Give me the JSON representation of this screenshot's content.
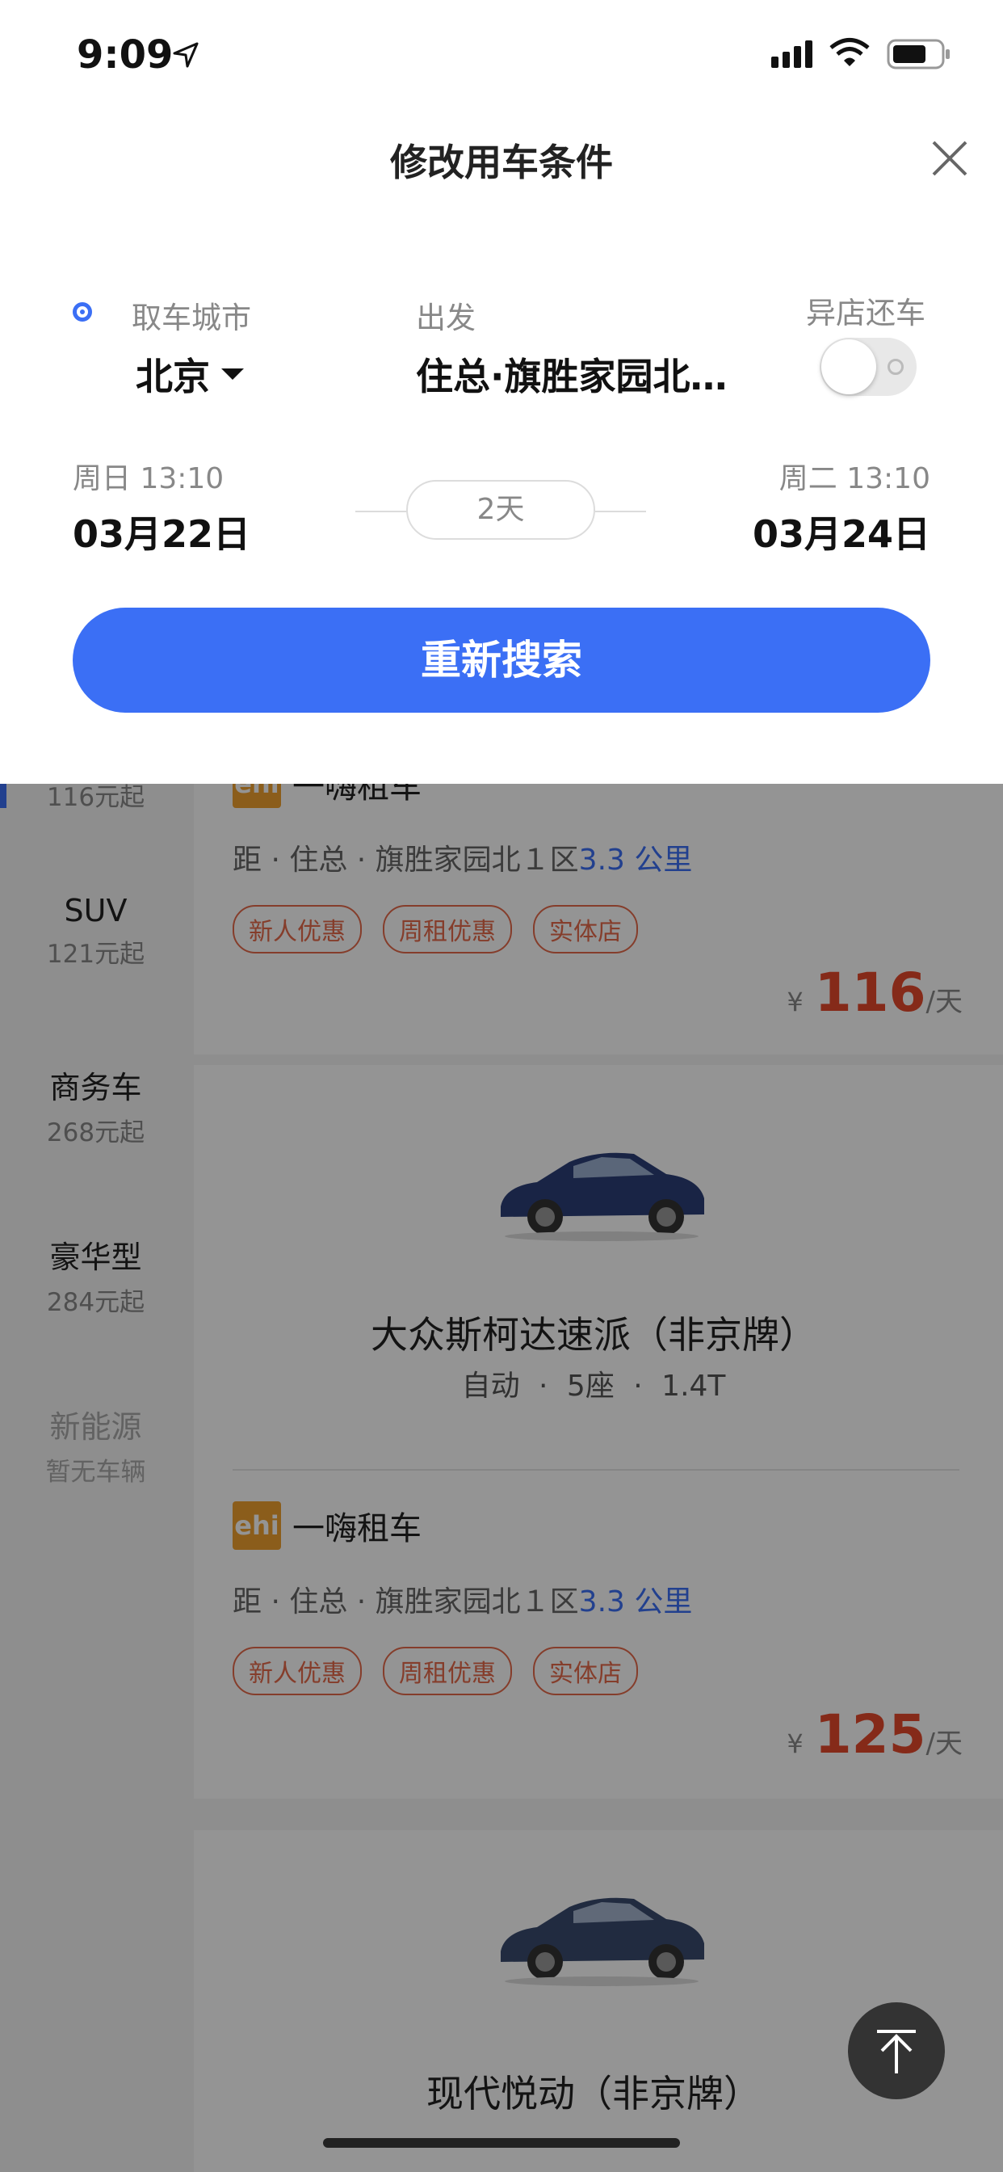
{
  "status_bar": {
    "time": "9:09"
  },
  "modal": {
    "title": "修改用车条件",
    "pickup_city_label": "取车城市",
    "pickup_city": "北京",
    "depart_label": "出发",
    "depart_value": "住总·旗胜家园北…",
    "return_other_label": "异店还车",
    "return_other_on": false,
    "start_weekday_time": "周日 13:10",
    "start_date": "03月22日",
    "duration": "2天",
    "end_weekday_time": "周二 13:10",
    "end_date": "03月24日",
    "search_button": "重新搜索"
  },
  "sidebar": {
    "items": [
      {
        "name": "",
        "sub": "116元起"
      },
      {
        "name": "SUV",
        "sub": "121元起"
      },
      {
        "name": "商务车",
        "sub": "268元起"
      },
      {
        "name": "豪华型",
        "sub": "284元起"
      },
      {
        "name": "新能源",
        "sub": "暂无车辆",
        "disabled": true
      }
    ]
  },
  "cars": [
    {
      "vendor": "一嗨租车",
      "distance_prefix": "距 · 住总 · 旗胜家园北１区",
      "distance_km": "3.3 公里",
      "tags": [
        "新人优惠",
        "周租优惠",
        "实体店"
      ],
      "price_currency": "¥",
      "price": "116",
      "price_unit": "/天"
    },
    {
      "title": "大众斯柯达速派（非京牌）",
      "spec": "自动 · 5座 · 1.4T",
      "vendor_logo": "ehi",
      "vendor": "一嗨租车",
      "distance_prefix": "距 · 住总 · 旗胜家园北１区",
      "distance_km": "3.3 公里",
      "tags": [
        "新人优惠",
        "周租优惠",
        "实体店"
      ],
      "price_currency": "¥",
      "price": "125",
      "price_unit": "/天"
    },
    {
      "title": "现代悦动（非京牌）"
    }
  ],
  "icons": [
    "location-arrow-icon",
    "signal-icon",
    "wifi-icon",
    "battery-icon",
    "close-icon",
    "location-dot-icon",
    "caret-down-icon",
    "back-to-top-icon"
  ],
  "colors": {
    "accent": "#3b6ff5",
    "price": "#e5492b",
    "tag": "#e56a4a"
  }
}
